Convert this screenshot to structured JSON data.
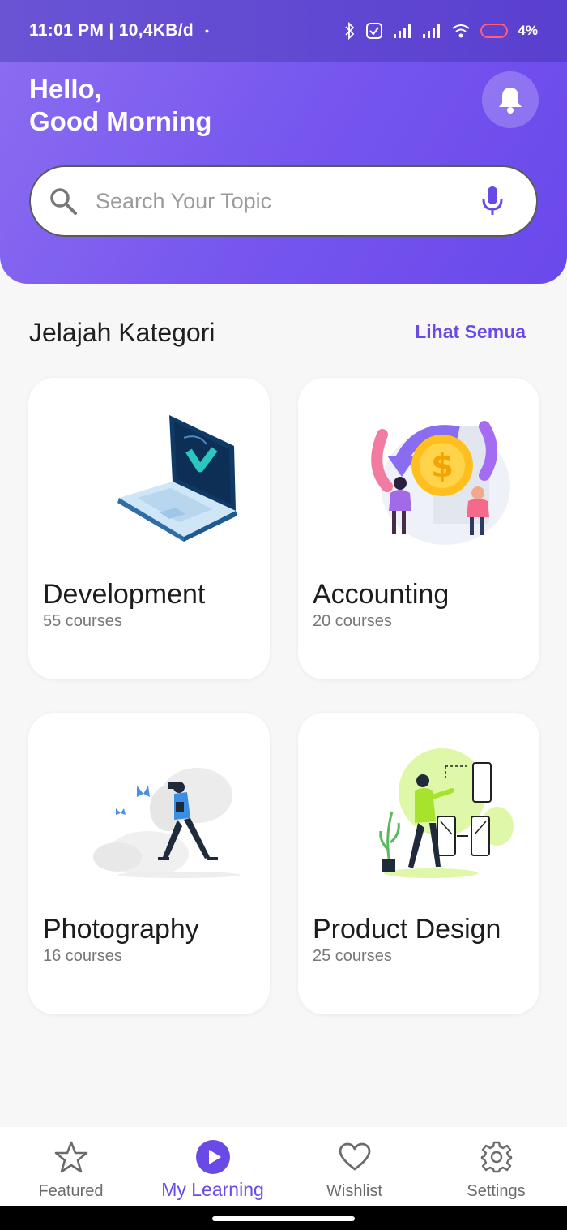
{
  "status_bar": {
    "time": "11:01 PM | 10,4KB/d",
    "dot": "•",
    "battery_percent": "4%",
    "icons": [
      "bluetooth-icon",
      "checkbox-icon",
      "signal-icon",
      "signal-icon",
      "wifi-icon",
      "battery-icon"
    ]
  },
  "header": {
    "greeting_line1": "Hello,",
    "greeting_line2": "Good Morning",
    "bell_icon": "bell-icon",
    "colors": {
      "gradient_start": "#8a6cf1",
      "gradient_end": "#6a48ec"
    }
  },
  "search": {
    "placeholder": "Search Your Topic",
    "value": "",
    "icon": "search-icon",
    "mic_icon": "microphone-icon"
  },
  "categories": {
    "title": "Jelajah Kategori",
    "see_all": "Lihat Semua",
    "items": [
      {
        "name": "Development",
        "count": "55 courses",
        "illustration": "laptop-illustration"
      },
      {
        "name": "Accounting",
        "count": "20 courses",
        "illustration": "coin-illustration"
      },
      {
        "name": "Photography",
        "count": "16 courses",
        "illustration": "photographer-illustration"
      },
      {
        "name": "Product Design",
        "count": "25 courses",
        "illustration": "designer-illustration"
      }
    ]
  },
  "bottom_nav": {
    "items": [
      {
        "label": "Featured",
        "icon": "star-icon",
        "active": false
      },
      {
        "label": "My Learning",
        "icon": "play-icon",
        "active": true
      },
      {
        "label": "Wishlist",
        "icon": "heart-icon",
        "active": false
      },
      {
        "label": "Settings",
        "icon": "gear-icon",
        "active": false
      }
    ]
  },
  "colors": {
    "accent": "#6a4ae6",
    "background": "#f7f7f8",
    "card": "#ffffff"
  }
}
